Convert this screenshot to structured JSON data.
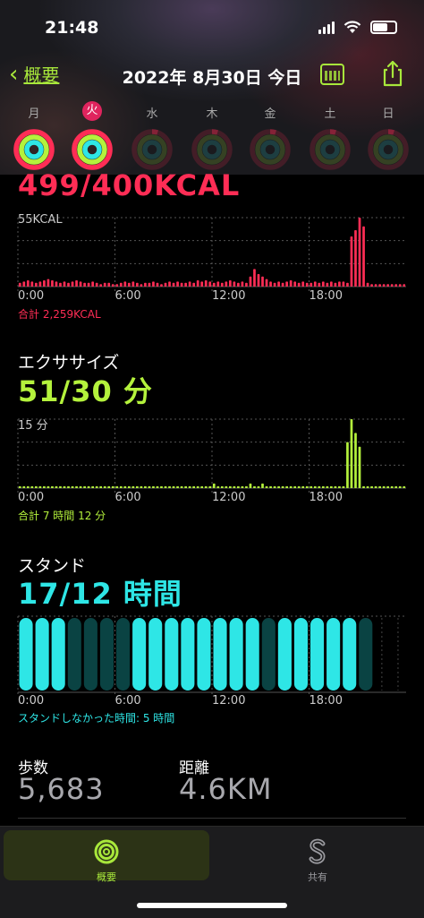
{
  "status": {
    "time": "21:48"
  },
  "nav": {
    "back_label": "概要",
    "title": "2022年 8月30日 今日"
  },
  "days": [
    {
      "label": "月",
      "selected": false,
      "dim": false
    },
    {
      "label": "火",
      "selected": true,
      "dim": false
    },
    {
      "label": "水",
      "selected": false,
      "dim": true
    },
    {
      "label": "木",
      "selected": false,
      "dim": true
    },
    {
      "label": "金",
      "selected": false,
      "dim": true
    },
    {
      "label": "土",
      "selected": false,
      "dim": true
    },
    {
      "label": "日",
      "selected": false,
      "dim": true
    }
  ],
  "move": {
    "value": "499/400KCAL",
    "ymax_label": "55KCAL",
    "total": "合計 2,259KCAL",
    "color": "#ff2d55"
  },
  "exercise": {
    "title": "エクササイズ",
    "value": "51/30 分",
    "ymax_label": "15 分",
    "total": "合計 7 時間 12 分",
    "color": "#b4f23c"
  },
  "stand": {
    "title": "スタンド",
    "value": "17/12 時間",
    "total": "スタンドしなかった時間: 5 時間",
    "color": "#2ee6e6"
  },
  "x_ticks": [
    "0:00",
    "6:00",
    "12:00",
    "18:00"
  ],
  "steps": {
    "label": "歩数",
    "value": "5,683"
  },
  "distance": {
    "label": "距離",
    "value": "4.6KM"
  },
  "tabs": {
    "summary": "概要",
    "sharing": "共有"
  },
  "chart_data": [
    {
      "type": "bar",
      "title": "499/400KCAL",
      "ylabel": "55KCAL",
      "x": [
        "0:00",
        "6:00",
        "12:00",
        "18:00"
      ],
      "series": [
        {
          "values": [
            3,
            4,
            5,
            4,
            3,
            4,
            5,
            6,
            5,
            4,
            3,
            4,
            3,
            4,
            5,
            4,
            3,
            3,
            4,
            3,
            2,
            3,
            3,
            2,
            2,
            3,
            4,
            3,
            4,
            3,
            2,
            3,
            3,
            4,
            3,
            2,
            3,
            4,
            3,
            4,
            3,
            3,
            4,
            3,
            5,
            4,
            5,
            4,
            3,
            4,
            3,
            4,
            5,
            4,
            3,
            4,
            3,
            8,
            14,
            10,
            8,
            6,
            4,
            3,
            4,
            3,
            4,
            5,
            4,
            3,
            4,
            3,
            3,
            4,
            3,
            4,
            3,
            4,
            3,
            4,
            4,
            3,
            40,
            45,
            55,
            48,
            3,
            2,
            2,
            2,
            2,
            2,
            2,
            2,
            2,
            2
          ]
        }
      ]
    },
    {
      "type": "bar",
      "title": "51/30 分",
      "ylabel": "15 分",
      "x": [
        "0:00",
        "6:00",
        "12:00",
        "18:00"
      ],
      "series": [
        {
          "values": [
            0,
            0,
            0,
            0,
            0,
            0,
            0,
            0,
            0,
            0,
            0,
            0,
            0,
            0,
            0,
            0,
            0,
            0,
            0,
            0,
            0,
            0,
            0,
            0,
            0,
            0,
            0,
            0,
            0,
            0,
            0,
            0,
            0,
            0,
            0,
            0,
            0,
            0,
            0,
            0,
            0,
            0,
            0,
            0,
            0,
            0,
            0,
            0,
            1,
            0,
            0,
            0,
            0,
            0,
            0,
            0,
            0,
            1,
            0,
            0,
            1,
            0,
            0,
            0,
            0,
            0,
            0,
            0,
            0,
            0,
            0,
            0,
            0,
            0,
            0,
            0,
            0,
            0,
            0,
            0,
            0,
            10,
            15,
            12,
            9,
            0,
            0,
            0,
            0,
            0,
            0,
            0,
            0,
            0,
            0,
            0
          ]
        }
      ]
    },
    {
      "type": "bar",
      "title": "17/12 時間",
      "x": [
        "0:00",
        "6:00",
        "12:00",
        "18:00"
      ],
      "series": [
        {
          "values": [
            1,
            1,
            1,
            0,
            0,
            0,
            0,
            1,
            1,
            1,
            1,
            1,
            1,
            1,
            1,
            0,
            1,
            1,
            1,
            1,
            1,
            0,
            0,
            0
          ]
        }
      ]
    }
  ]
}
